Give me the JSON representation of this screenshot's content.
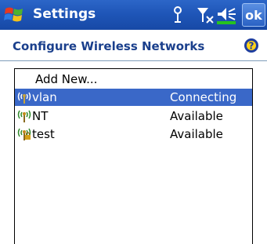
{
  "titlebar": {
    "app_title": "Settings",
    "ok_label": "ok",
    "icons": [
      "windows-start-icon",
      "connectivity-icon",
      "signal-icon",
      "volume-icon",
      "battery-icon"
    ]
  },
  "header": {
    "title": "Configure Wireless Networks",
    "help_icon": "help-icon"
  },
  "networks": {
    "add_new_label": "Add New...",
    "items": [
      {
        "name": "vlan",
        "status": "Connecting",
        "selected": true,
        "icon": "wireless-network-icon"
      },
      {
        "name": "NT",
        "status": "Available",
        "selected": false,
        "icon": "wireless-network-icon"
      },
      {
        "name": "test",
        "status": "Available",
        "selected": false,
        "icon": "wireless-network-icon"
      }
    ]
  },
  "colors": {
    "titlebar": "#1f56b8",
    "title_text": "#1a3f8c",
    "selection": "#3a68c8",
    "help": "#1e3d9e"
  }
}
